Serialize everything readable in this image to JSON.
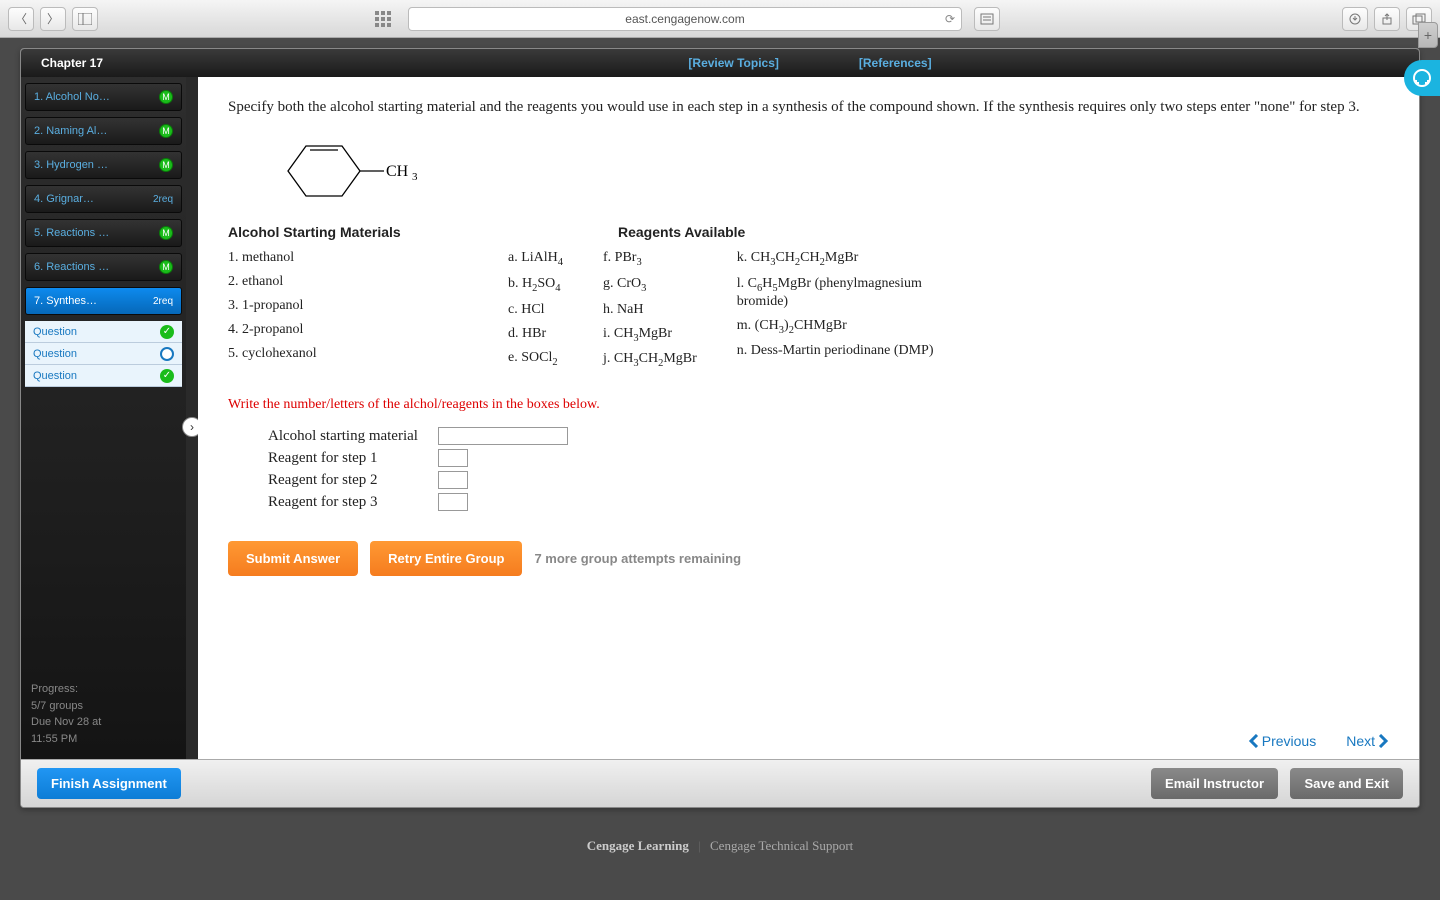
{
  "browser": {
    "url": "east.cengagenow.com"
  },
  "topbar": {
    "chapter": "Chapter 17",
    "review": "[Review Topics]",
    "references": "[References]"
  },
  "sidebar": {
    "items": [
      {
        "label": "1. Alcohol No…",
        "badge": "M"
      },
      {
        "label": "2. Naming Al…",
        "badge": "M"
      },
      {
        "label": "3. Hydrogen …",
        "badge": "M"
      },
      {
        "label": "4. Grignar…",
        "badge": "2req"
      },
      {
        "label": "5. Reactions …",
        "badge": "M"
      },
      {
        "label": "6. Reactions …",
        "badge": "M"
      },
      {
        "label": "7. Synthes…",
        "badge": "2req"
      }
    ],
    "subitems": [
      {
        "label": "Question",
        "status": "green"
      },
      {
        "label": "Question",
        "status": "blue"
      },
      {
        "label": "Question",
        "status": "green"
      }
    ],
    "progress": {
      "title": "Progress:",
      "groups": "5/7 groups",
      "due": "Due Nov 28 at",
      "time": "11:55 PM"
    }
  },
  "content": {
    "intro": "Specify both the alcohol starting material and the reagents you would use in each step in a synthesis of the compound shown. If the synthesis requires only two steps enter \"none\" for step 3.",
    "structure_label": "CH",
    "structure_sub": "3",
    "alc_heading": "Alcohol Starting Materials",
    "reag_heading": "Reagents Available",
    "alc_list": [
      "1. methanol",
      "2. ethanol",
      "3. 1-propanol",
      "4. 2-propanol",
      "5. cyclohexanol"
    ],
    "reagents_col1": [
      "a. LiAlH<sub>4</sub>",
      "b. H<sub>2</sub>SO<sub>4</sub>",
      "c. HCl",
      "d. HBr",
      "e. SOCl<sub>2</sub>"
    ],
    "reagents_col2": [
      "f. PBr<sub>3</sub>",
      "g. CrO<sub>3</sub>",
      "h. NaH",
      "i.  CH<sub>3</sub>MgBr",
      "j.  CH<sub>3</sub>CH<sub>2</sub>MgBr"
    ],
    "reagents_col3": [
      "k. CH<sub>3</sub>CH<sub>2</sub>CH<sub>2</sub>MgBr",
      "l. C<sub>6</sub>H<sub>5</sub>MgBr (phenylmagnesium bromide)",
      "m. (CH<sub>3</sub>)<sub>2</sub>CHMgBr",
      "n. Dess-Martin periodinane (DMP)"
    ],
    "red_line": "Write the number/letters of the alchol/reagents in the boxes below.",
    "inputs": [
      {
        "label": "Alcohol starting material",
        "cls": "long"
      },
      {
        "label": "Reagent for step 1",
        "cls": "short"
      },
      {
        "label": "Reagent for step 2",
        "cls": "short"
      },
      {
        "label": "Reagent for step 3",
        "cls": "short"
      }
    ],
    "submit": "Submit Answer",
    "retry": "Retry Entire Group",
    "attempts": "7 more group attempts remaining",
    "prev": "Previous",
    "next": "Next"
  },
  "bottombar": {
    "finish": "Finish Assignment",
    "email": "Email Instructor",
    "save": "Save and Exit"
  },
  "footer": {
    "brand": "Cengage Learning",
    "support": "Cengage Technical Support"
  }
}
